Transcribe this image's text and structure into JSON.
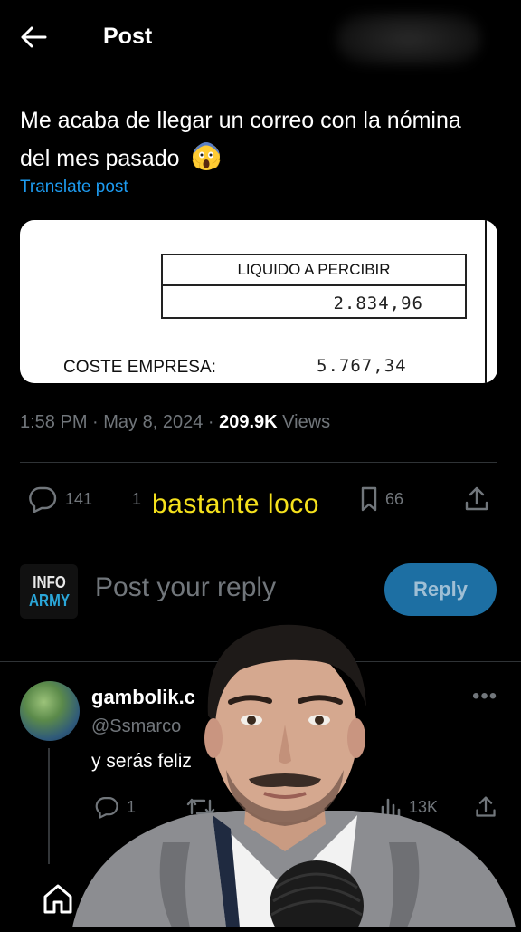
{
  "header": {
    "title": "Post"
  },
  "post": {
    "text": "Me acaba de llegar un correo con la nómina del mes pasado",
    "translate_label": "Translate post",
    "image": {
      "box_label": "LIQUIDO A PERCIBIR",
      "box_value": "2.834,96",
      "row_label": "COSTE EMPRESA:",
      "row_value": "5.767,34"
    },
    "time_date": "1:58 PM · May 8, 2024 · ",
    "views_count": "209.9K",
    "views_label": " Views"
  },
  "actions": {
    "replies": "141",
    "reposts": "1",
    "bookmarks": "66"
  },
  "subtitle": "bastante loco",
  "composer": {
    "avatar_line1": "INFO",
    "avatar_line2": "ARMY",
    "placeholder": "Post your reply",
    "reply_label": "Reply"
  },
  "comment": {
    "name": "gambolik.c",
    "handle": "@Ssmarco",
    "text": "y serás feliz",
    "replies": "1",
    "views": "13K"
  },
  "colors": {
    "accent": "#1d9bf0",
    "subtitle": "#f5e11c",
    "reply_button": "#1d6fa3",
    "muted": "#71767b"
  }
}
